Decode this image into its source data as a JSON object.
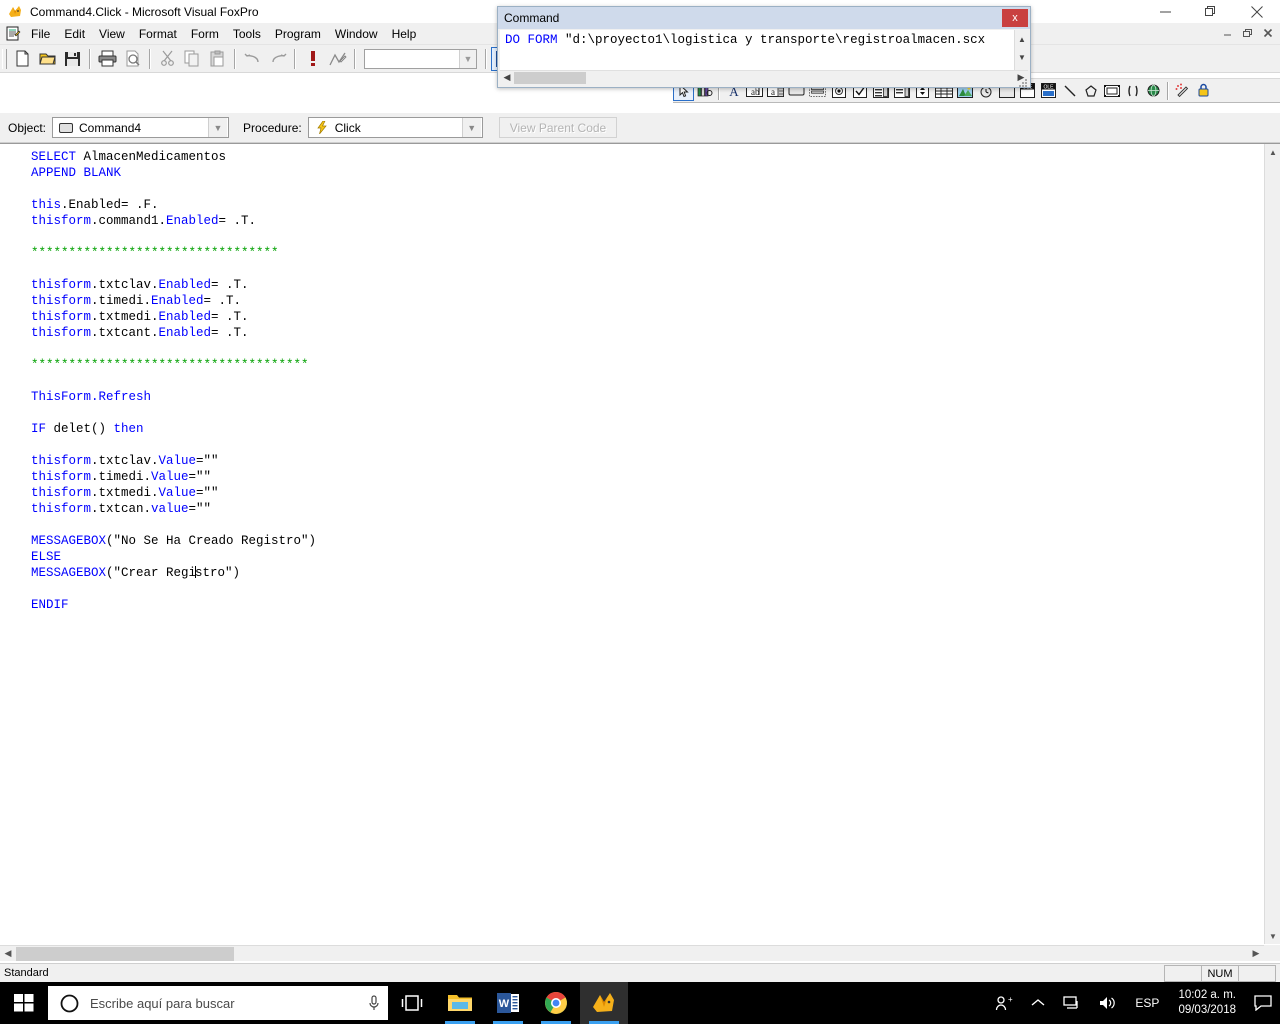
{
  "window": {
    "title": "Command4.Click - Microsoft Visual FoxPro",
    "app_icon": "foxpro-icon",
    "minimize": "minimize-icon",
    "maximize": "restore-icon",
    "close": "close-icon"
  },
  "menubar": {
    "doc_icon": "document-icon",
    "items": [
      {
        "label": "File"
      },
      {
        "label": "Edit"
      },
      {
        "label": "View"
      },
      {
        "label": "Format"
      },
      {
        "label": "Form"
      },
      {
        "label": "Tools"
      },
      {
        "label": "Program"
      },
      {
        "label": "Window"
      },
      {
        "label": "Help"
      }
    ],
    "mdi": {
      "minimize": "_",
      "restore": "❐",
      "close": "✖"
    }
  },
  "toolbar": {
    "buttons": [
      {
        "name": "new-icon"
      },
      {
        "name": "open-folder-icon"
      },
      {
        "name": "save-disk-icon"
      },
      {
        "name": "print-icon"
      },
      {
        "name": "print-preview-icon"
      },
      {
        "name": "cut-scissors-icon"
      },
      {
        "name": "copy-icon"
      },
      {
        "name": "paste-icon"
      },
      {
        "name": "undo-icon"
      },
      {
        "name": "redo-icon"
      },
      {
        "name": "run-exclamation-icon"
      },
      {
        "name": "modify-form-icon"
      }
    ],
    "combo_value": "",
    "right_buttons": [
      {
        "name": "form-designer-icon"
      },
      {
        "name": "database-designer-icon"
      },
      {
        "name": "report-designer-icon"
      }
    ]
  },
  "form_controls_toolbar": {
    "buttons": [
      {
        "name": "select-objects-icon"
      },
      {
        "name": "view-classes-icon"
      },
      {
        "name": "label-icon"
      },
      {
        "name": "textbox-icon"
      },
      {
        "name": "editbox-icon"
      },
      {
        "name": "command-button-icon"
      },
      {
        "name": "command-group-icon"
      },
      {
        "name": "option-group-icon"
      },
      {
        "name": "checkbox-icon"
      },
      {
        "name": "combobox-icon"
      },
      {
        "name": "listbox-icon"
      },
      {
        "name": "spinner-icon"
      },
      {
        "name": "grid-icon"
      },
      {
        "name": "image-icon"
      },
      {
        "name": "timer-icon"
      },
      {
        "name": "page-frame-icon"
      },
      {
        "name": "ole-container-icon"
      },
      {
        "name": "ole-bound-icon"
      },
      {
        "name": "line-icon"
      },
      {
        "name": "shape-icon"
      },
      {
        "name": "container-icon"
      },
      {
        "name": "separator-icon"
      },
      {
        "name": "hyperlink-icon"
      },
      {
        "name": "builder-lock-icon"
      },
      {
        "name": "button-lock-icon"
      }
    ]
  },
  "objectbar": {
    "object_label": "Object:",
    "object_value": "Command4",
    "object_icon": "command-button-icon",
    "procedure_label": "Procedure:",
    "procedure_value": "Click",
    "procedure_icon": "lightning-bolt-icon",
    "view_parent_code": "View Parent Code"
  },
  "editor": {
    "lines": [
      [
        {
          "t": "SELECT",
          "c": "kw"
        },
        {
          "t": " AlmacenMedicamentos",
          "c": "id"
        }
      ],
      [
        {
          "t": "APPEND BLANK",
          "c": "kw"
        }
      ],
      [],
      [
        {
          "t": "this",
          "c": "kw"
        },
        {
          "t": ".Enabled",
          "c": "id"
        },
        {
          "t": "= ",
          "c": "id"
        },
        {
          "t": ".F.",
          "c": "id"
        }
      ],
      [
        {
          "t": "thisform",
          "c": "kw"
        },
        {
          "t": ".command1.",
          "c": "id"
        },
        {
          "t": "Enabled",
          "c": "kw"
        },
        {
          "t": "= .T.",
          "c": "id"
        }
      ],
      [],
      [
        {
          "t": "*********************************",
          "c": "cm"
        }
      ],
      [],
      [
        {
          "t": "thisform",
          "c": "kw"
        },
        {
          "t": ".txtclav.",
          "c": "id"
        },
        {
          "t": "Enabled",
          "c": "kw"
        },
        {
          "t": "= .T.",
          "c": "id"
        }
      ],
      [
        {
          "t": "thisform",
          "c": "kw"
        },
        {
          "t": ".timedi.",
          "c": "id"
        },
        {
          "t": "Enabled",
          "c": "kw"
        },
        {
          "t": "= .T.",
          "c": "id"
        }
      ],
      [
        {
          "t": "thisform",
          "c": "kw"
        },
        {
          "t": ".txtmedi.",
          "c": "id"
        },
        {
          "t": "Enabled",
          "c": "kw"
        },
        {
          "t": "= .T.",
          "c": "id"
        }
      ],
      [
        {
          "t": "thisform",
          "c": "kw"
        },
        {
          "t": ".txtcant.",
          "c": "id"
        },
        {
          "t": "Enabled",
          "c": "kw"
        },
        {
          "t": "= .T.",
          "c": "id"
        }
      ],
      [],
      [
        {
          "t": "*************************************",
          "c": "cm"
        }
      ],
      [],
      [
        {
          "t": "ThisForm.Refresh",
          "c": "kw"
        }
      ],
      [],
      [
        {
          "t": "IF ",
          "c": "kw"
        },
        {
          "t": "delet",
          "c": "id"
        },
        {
          "t": "() ",
          "c": "id"
        },
        {
          "t": "then",
          "c": "kw"
        }
      ],
      [],
      [
        {
          "t": "thisform",
          "c": "kw"
        },
        {
          "t": ".txtclav.",
          "c": "id"
        },
        {
          "t": "Value",
          "c": "kw"
        },
        {
          "t": "=\"\"",
          "c": "id"
        }
      ],
      [
        {
          "t": "thisform",
          "c": "kw"
        },
        {
          "t": ".timedi.",
          "c": "id"
        },
        {
          "t": "Value",
          "c": "kw"
        },
        {
          "t": "=\"\"",
          "c": "id"
        }
      ],
      [
        {
          "t": "thisform",
          "c": "kw"
        },
        {
          "t": ".txtmedi.",
          "c": "id"
        },
        {
          "t": "Value",
          "c": "kw"
        },
        {
          "t": "=\"\"",
          "c": "id"
        }
      ],
      [
        {
          "t": "thisform",
          "c": "kw"
        },
        {
          "t": ".txtcan.",
          "c": "id"
        },
        {
          "t": "value",
          "c": "kw"
        },
        {
          "t": "=\"\"",
          "c": "id"
        }
      ],
      [],
      [
        {
          "t": "MESSAGEBOX",
          "c": "kw"
        },
        {
          "t": "(\"No Se Ha Creado Registro\")",
          "c": "id"
        }
      ],
      [
        {
          "t": "ELSE",
          "c": "kw"
        }
      ],
      [
        {
          "t": "MESSAGEBOX",
          "c": "kw"
        },
        {
          "t": "(\"Crear Regi",
          "c": "id"
        },
        {
          "t": "|CARET|",
          "c": "caret"
        },
        {
          "t": "stro\")",
          "c": "id"
        }
      ],
      [],
      [
        {
          "t": "ENDIF",
          "c": "kw"
        }
      ]
    ]
  },
  "command_window": {
    "title": "Command",
    "close_label": "x",
    "command_text": "DO FORM \"d:\\proyecto1\\logistica y transporte\\registroalmacen.scx",
    "command_keyword": "DO FORM",
    "command_rest": " \"d:\\proyecto1\\logistica y transporte\\registroalmacen.scx"
  },
  "statusbar": {
    "text": "Standard",
    "panels": [
      "",
      "NUM",
      ""
    ]
  },
  "taskbar": {
    "start_icon": "windows-start-icon",
    "search_icon": "cortana-circle-icon",
    "search_placeholder": "Escribe aquí para buscar",
    "mic_icon": "microphone-icon",
    "task_view_icon": "task-view-icon",
    "apps": [
      {
        "name": "file-explorer-icon",
        "active": false,
        "running": true
      },
      {
        "name": "word-icon",
        "active": false,
        "running": true
      },
      {
        "name": "chrome-icon",
        "active": false,
        "running": true
      },
      {
        "name": "foxpro-icon",
        "active": true,
        "running": true
      }
    ],
    "tray": {
      "people_icon": "people-icon",
      "chevron_icon": "show-hidden-icons-icon",
      "network_icon": "network-icon",
      "volume_icon": "volume-icon",
      "language": "ESP",
      "time": "10:02 a. m.",
      "date": "09/03/2018",
      "notifications_icon": "action-center-icon"
    }
  },
  "colors": {
    "keyword": "#0000ff",
    "comment": "#00a000",
    "identifier": "#000000",
    "titlebar_cmd": "#cfdaeb",
    "close_red": "#c94040",
    "accent_blue": "#2a6fc9"
  }
}
